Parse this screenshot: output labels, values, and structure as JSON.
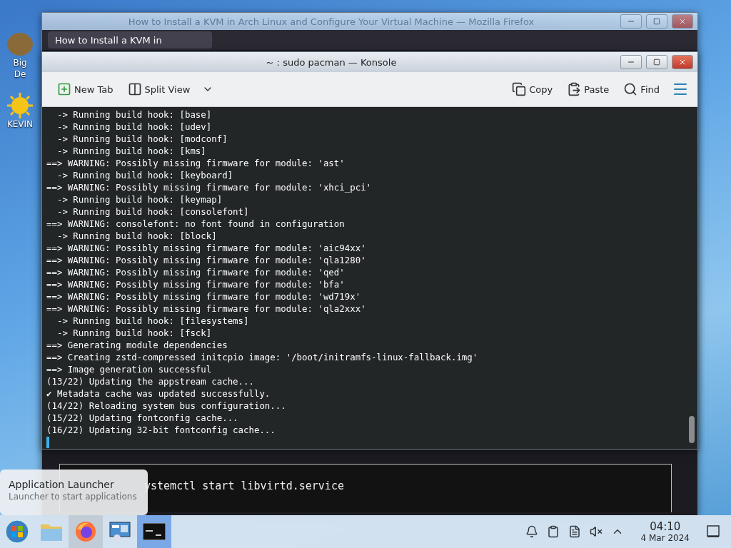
{
  "desktop": {
    "icons": [
      {
        "kind": "book",
        "lines": [
          "Big",
          "De"
        ]
      },
      {
        "kind": "sun",
        "lines": [
          "KEVIN"
        ]
      }
    ]
  },
  "browser": {
    "title": "How to Install a KVM in Arch Linux and Configure Your Virtual Machine — Mozilla Firefox",
    "tab": "How to Install a KVM in ",
    "code": "ystemctl start libvirtd.service"
  },
  "konsole": {
    "title": "~ : sudo pacman — Konsole",
    "toolbar_left": [
      {
        "kind": "newtab",
        "label": "New Tab"
      },
      {
        "kind": "split",
        "label": "Split View"
      }
    ],
    "toolbar_right": [
      {
        "kind": "copy",
        "label": "Copy"
      },
      {
        "kind": "paste",
        "label": "Paste"
      },
      {
        "kind": "find",
        "label": "Find"
      }
    ],
    "lines": [
      "  -> Running build hook: [base]",
      "  -> Running build hook: [udev]",
      "  -> Running build hook: [modconf]",
      "  -> Running build hook: [kms]",
      "==> WARNING: Possibly missing firmware for module: 'ast'",
      "  -> Running build hook: [keyboard]",
      "==> WARNING: Possibly missing firmware for module: 'xhci_pci'",
      "  -> Running build hook: [keymap]",
      "  -> Running build hook: [consolefont]",
      "==> WARNING: consolefont: no font found in configuration",
      "  -> Running build hook: [block]",
      "==> WARNING: Possibly missing firmware for module: 'aic94xx'",
      "==> WARNING: Possibly missing firmware for module: 'qla1280'",
      "==> WARNING: Possibly missing firmware for module: 'qed'",
      "==> WARNING: Possibly missing firmware for module: 'bfa'",
      "==> WARNING: Possibly missing firmware for module: 'wd719x'",
      "==> WARNING: Possibly missing firmware for module: 'qla2xxx'",
      "  -> Running build hook: [filesystems]",
      "  -> Running build hook: [fsck]",
      "==> Generating module dependencies",
      "==> Creating zstd-compressed initcpio image: '/boot/initramfs-linux-fallback.img'",
      "==> Image generation successful",
      "(13/22) Updating the appstream cache...",
      "✔ Metadata cache was updated successfully.",
      "(14/22) Reloading system bus configuration...",
      "(15/22) Updating fontconfig cache...",
      "(16/22) Updating 32-bit fontconfig cache..."
    ]
  },
  "tooltip": {
    "title": "Application Launcher",
    "subtitle": "Launcher to start applications"
  },
  "taskbar": {
    "items": [
      {
        "kind": "start",
        "selected": false,
        "hovered": false
      },
      {
        "kind": "folder",
        "selected": false,
        "hovered": false
      },
      {
        "kind": "firefox",
        "selected": false,
        "hovered": true
      },
      {
        "kind": "settings",
        "selected": false,
        "hovered": false
      },
      {
        "kind": "terminal",
        "selected": true,
        "hovered": false
      }
    ],
    "tray": [
      {
        "kind": "bell"
      },
      {
        "kind": "clipboard"
      },
      {
        "kind": "notes"
      },
      {
        "kind": "muted"
      },
      {
        "kind": "caret"
      }
    ],
    "time": "04:10",
    "date": "4 Mar 2024"
  }
}
